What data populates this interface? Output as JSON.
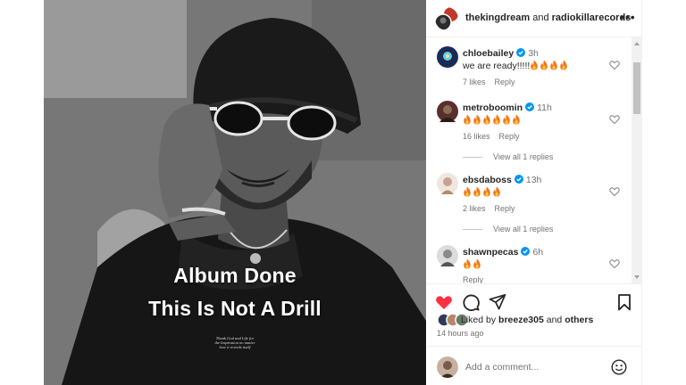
{
  "post": {
    "overlay_lines": [
      "Album Done",
      "This Is Not A Drill"
    ],
    "small_caption": [
      "Thank God and Life for",
      "the Inspiration no matter",
      "how it reveals itself"
    ]
  },
  "header": {
    "author": "thekingdream",
    "conjunction": "and",
    "collaborator": "radiokillarecords",
    "more_icon": "more-horizontal-icon"
  },
  "comments": [
    {
      "user": "chloebailey",
      "verified": true,
      "time": "3h",
      "text": "we are ready!!!!!",
      "fires": 4,
      "likes": "7 likes",
      "reply": "Reply",
      "avatar_color": "#1d2a55"
    },
    {
      "user": "metroboomin",
      "verified": true,
      "time": "11h",
      "text": "",
      "fires": 6,
      "likes": "16 likes",
      "reply": "Reply",
      "replies": "View all 1 replies",
      "avatar_color": "#5a2e2a"
    },
    {
      "user": "ebsdaboss",
      "verified": true,
      "time": "13h",
      "text": "",
      "fires": 4,
      "likes": "2 likes",
      "reply": "Reply",
      "replies": "View all 1 replies",
      "avatar_color": "#c9a28a"
    },
    {
      "user": "shawnpecas",
      "verified": true,
      "time": "6h",
      "text": "",
      "fires": 2,
      "likes": "",
      "reply": "Reply",
      "avatar_color": "#8a8a8a"
    }
  ],
  "actions": {
    "like_icon": "heart-filled-icon",
    "comment_icon": "comment-icon",
    "share_icon": "send-icon",
    "save_icon": "bookmark-icon",
    "like_color": "#ff3040"
  },
  "likes": {
    "prefix": "Liked by",
    "user": "breeze305",
    "conjunction": "and",
    "others": "others"
  },
  "time_ago": "14 hours ago",
  "add_comment": {
    "placeholder": "Add a comment...",
    "emoji_icon": "emoji-icon"
  },
  "colors": {
    "verified": "#0095f6",
    "fire_outer": "#f2761b",
    "fire_inner": "#ffc83d"
  }
}
